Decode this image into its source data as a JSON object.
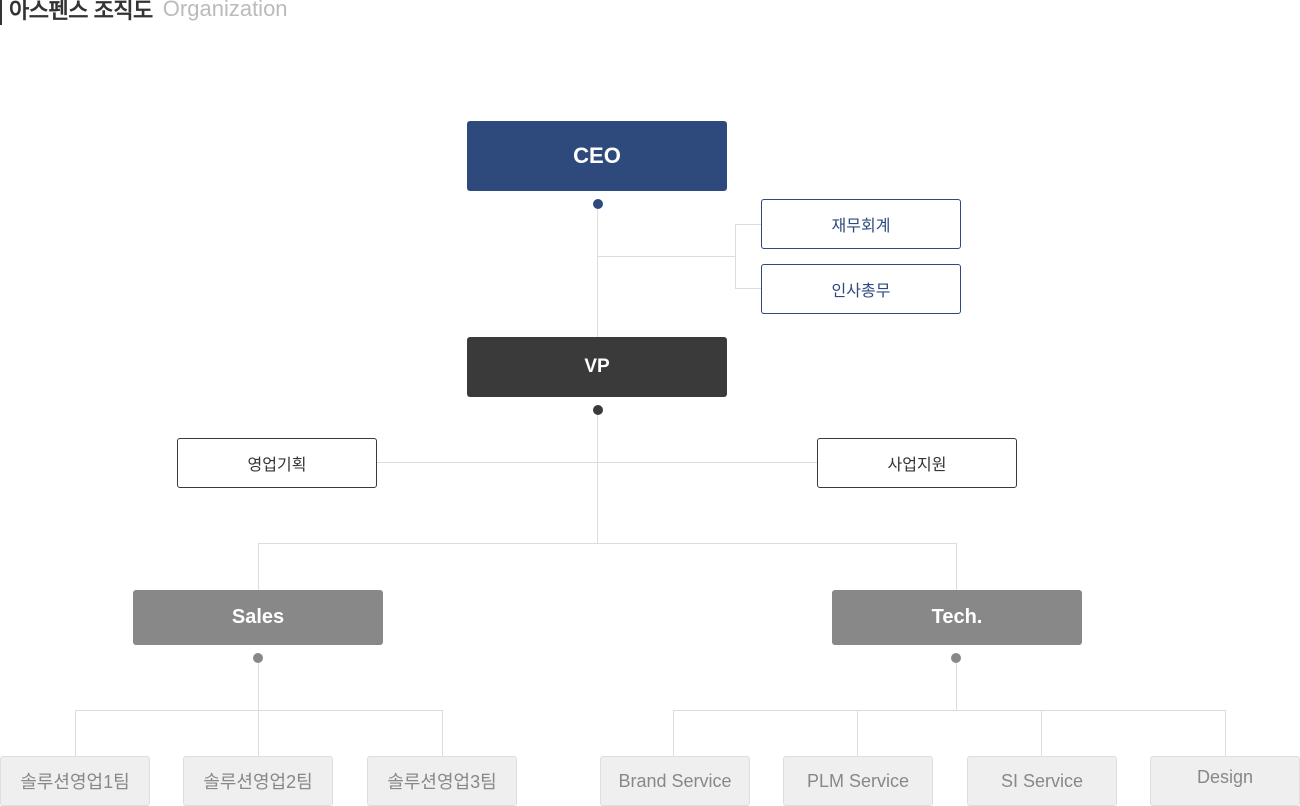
{
  "header": {
    "title_ko": "아스펜스 조직도",
    "title_en": "Organization"
  },
  "colors": {
    "ceo": "#2e4a7d",
    "vp": "#3a3a3a",
    "division": "#888888",
    "team_bg": "#efefef",
    "connector": "#dcdcdc"
  },
  "org": {
    "ceo": {
      "label": "CEO"
    },
    "ceo_staff": [
      {
        "label": "재무회계"
      },
      {
        "label": "인사총무"
      }
    ],
    "vp": {
      "label": "VP"
    },
    "vp_staff": [
      {
        "label": "영업기획"
      },
      {
        "label": "사업지원"
      }
    ],
    "divisions": [
      {
        "label": "Sales",
        "teams": [
          {
            "label": "솔루션영업1팀"
          },
          {
            "label": "솔루션영업2팀"
          },
          {
            "label": "솔루션영업3팀"
          }
        ]
      },
      {
        "label": "Tech.",
        "teams": [
          {
            "label": "Brand Service"
          },
          {
            "label": "PLM Service"
          },
          {
            "label": "SI Service"
          },
          {
            "label": "Design"
          }
        ]
      }
    ]
  }
}
